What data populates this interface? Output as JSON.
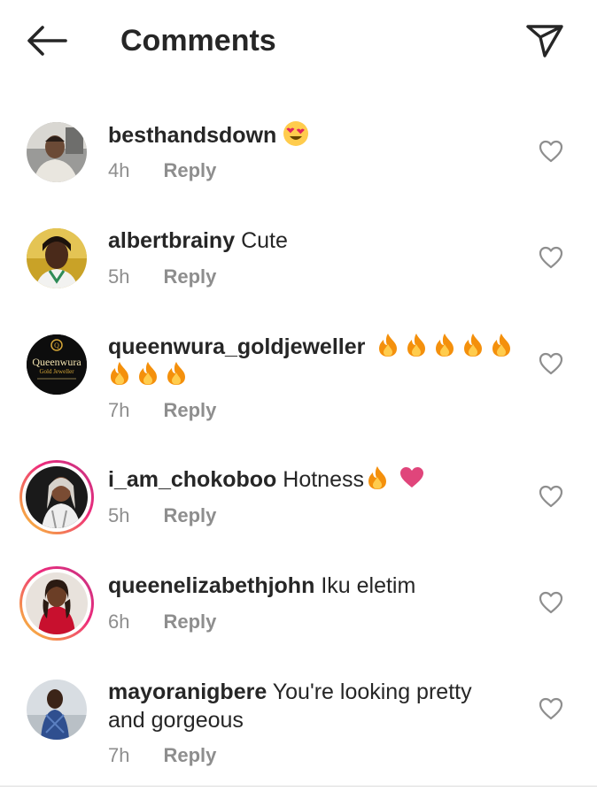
{
  "header": {
    "title": "Comments"
  },
  "comments": [
    {
      "username": "besthandsdown",
      "text": "",
      "emoji": "smiling-face-heart-eyes",
      "time": "4h",
      "reply": "Reply"
    },
    {
      "username": "albertbrainy",
      "text": "Cute",
      "time": "5h",
      "reply": "Reply"
    },
    {
      "username": "queenwura_goldjeweller",
      "text": "",
      "emoji": "fire x8",
      "time": "7h",
      "reply": "Reply",
      "avatar_text": {
        "brand": "Queenwura",
        "sub": "Gold Jeweller"
      }
    },
    {
      "username": "i_am_chokoboo",
      "text": "Hotness",
      "emoji": "fire + heart",
      "time": "5h",
      "reply": "Reply"
    },
    {
      "username": "queenelizabethjohn",
      "text": "Iku eletim",
      "time": "6h",
      "reply": "Reply"
    },
    {
      "username": "mayoranigbere",
      "text": "You're looking pretty",
      "text2": "and gorgeous",
      "time": "7h",
      "reply": "Reply"
    }
  ],
  "colors": {
    "text": "#262626",
    "meta": "#8e8e8e",
    "fire": "#f4900c",
    "heart": "#e0457b"
  }
}
